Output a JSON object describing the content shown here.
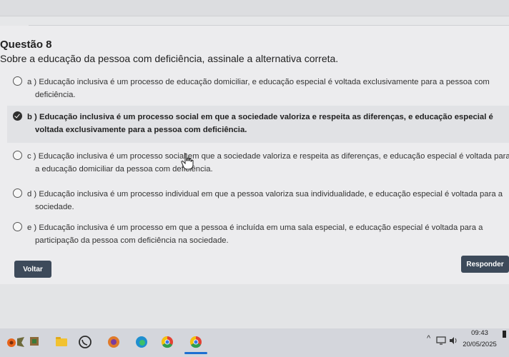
{
  "question": {
    "title": "Questão 8",
    "text": "Sobre a educação da pessoa com deficiência, assinale a alternativa correta."
  },
  "options": [
    {
      "line1": "a ) Educação inclusiva é um processo de educação domiciliar, e educação especial é voltada exclusivamente para a pessoa com",
      "line2": "deficiência.",
      "selected": false
    },
    {
      "line1": "b ) Educação inclusiva é um processo social em que a sociedade valoriza e respeita as diferenças, e educação especial é",
      "line2": "voltada exclusivamente para a pessoa com deficiência.",
      "selected": true
    },
    {
      "line1": "c ) Educação inclusiva é um processo social em que a sociedade valoriza e respeita as diferenças, e educação especial é voltada para",
      "line2": "a educação domiciliar da pessoa com deficiência.",
      "selected": false
    },
    {
      "line1": "d ) Educação inclusiva é um processo individual em que a pessoa valoriza sua individualidade, e educação especial é voltada para a",
      "line2": "sociedade.",
      "selected": false
    },
    {
      "line1": "e ) Educação inclusiva é um processo em que a pessoa é incluída em uma sala especial, e educação especial é voltada para a",
      "line2": "participação da pessoa com deficiência na sociedade.",
      "selected": false
    }
  ],
  "buttons": {
    "back_label": "Voltar",
    "submit_label": "Responder"
  },
  "taskbar": {
    "time": "09:43",
    "date": "20/05/2025",
    "icons": [
      "flower-wallpaper-icon",
      "game-icon",
      "file-explorer-icon",
      "whatsapp-icon",
      "browser-icon",
      "edge-icon",
      "chrome-icon",
      "chrome-profile-icon"
    ]
  },
  "colors": {
    "button_bg": "#3d4a5a",
    "selected_bg": "#e1e2e5",
    "taskbar_bg": "#d4d6dc",
    "active_underline": "#1d6fd1"
  }
}
